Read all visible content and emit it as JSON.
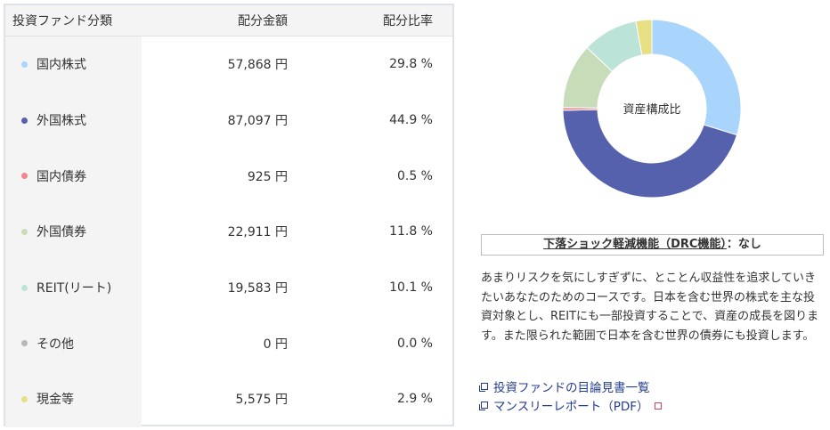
{
  "table": {
    "headers": {
      "category": "投資ファンド分類",
      "amount": "配分金額",
      "ratio": "配分比率"
    },
    "rows": [
      {
        "name": "国内株式",
        "amount": "57,868 円",
        "ratio": "29.8 %",
        "color": "#a9d4fb",
        "percent": 29.8
      },
      {
        "name": "外国株式",
        "amount": "87,097 円",
        "ratio": "44.9 %",
        "color": "#5661ae",
        "percent": 44.9
      },
      {
        "name": "国内債券",
        "amount": "925 円",
        "ratio": "0.5 %",
        "color": "#f2858c",
        "percent": 0.5
      },
      {
        "name": "外国債券",
        "amount": "22,911 円",
        "ratio": "11.8 %",
        "color": "#c7dcb8",
        "percent": 11.8
      },
      {
        "name": "REIT(リート)",
        "amount": "19,583 円",
        "ratio": "10.1 %",
        "color": "#bce3d8",
        "percent": 10.1
      },
      {
        "name": "その他",
        "amount": "0 円",
        "ratio": "0.0 %",
        "color": "#b8b8b8",
        "percent": 0.0
      },
      {
        "name": "現金等",
        "amount": "5,575 円",
        "ratio": "2.9 %",
        "color": "#e6df84",
        "percent": 2.9
      }
    ]
  },
  "chart": {
    "center_label": "資産構成比"
  },
  "drc": {
    "label": "下落ショック軽減機能（DRC機能）",
    "value": "：なし"
  },
  "description": "あまりリスクを気にしすぎずに、とことん収益性を追求していきたいあなたのためのコースです。日本を含む世界の株式を主な投資対象とし、REITにも一部投資することで、資産の成長を図ります。また限られた範囲で日本を含む世界の債券にも投資します。",
  "links": [
    {
      "label": "投資ファンドの目論見書一覧",
      "pdf": false
    },
    {
      "label": "マンスリーレポート（PDF）",
      "pdf": true
    }
  ]
}
